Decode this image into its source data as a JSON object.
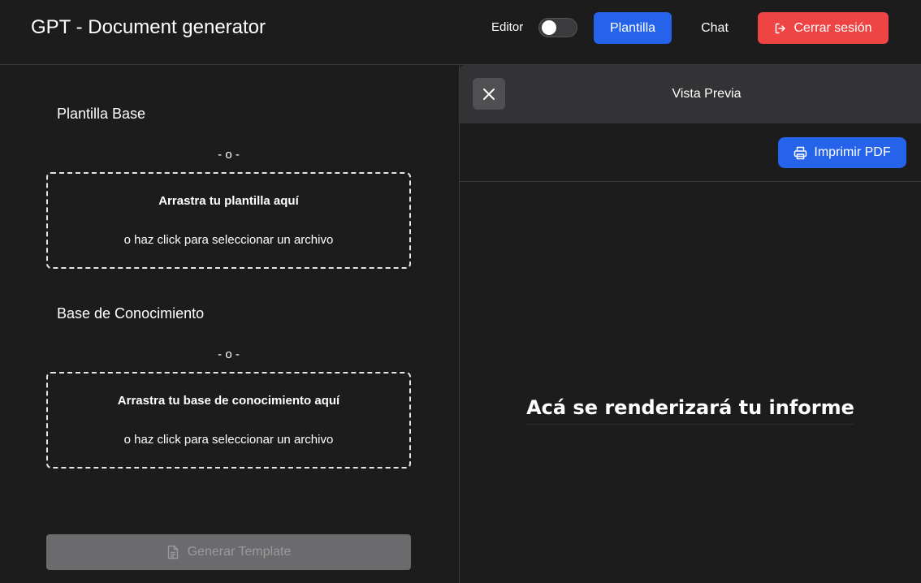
{
  "header": {
    "title": "GPT - Document generator",
    "editor_label": "Editor",
    "editor_toggle_on": false,
    "plantilla_label": "Plantilla",
    "chat_label": "Chat",
    "logout_label": "Cerrar sesión",
    "logout_icon": "logout-icon"
  },
  "left": {
    "template_section": {
      "title": "Plantilla Base",
      "separator": "- o -",
      "drop_title": "Arrastra tu plantilla aquí",
      "drop_sub": "o haz click para seleccionar un archivo"
    },
    "knowledge_section": {
      "title": "Base de Conocimiento",
      "separator": "- o -",
      "drop_title": "Arrastra tu base de conocimiento aquí",
      "drop_sub": "o haz click para seleccionar un archivo"
    },
    "generate_label": "Generar Template",
    "generate_icon": "document-icon"
  },
  "preview": {
    "title": "Vista Previa",
    "close_icon": "close-icon",
    "print_label": "Imprimir PDF",
    "print_icon": "printer-icon",
    "placeholder": "Acá se renderizará tu informe"
  },
  "colors": {
    "background": "#1c1c1d",
    "primary": "#2563eb",
    "danger": "#ef4444",
    "disabled": "#6b6b6d"
  }
}
